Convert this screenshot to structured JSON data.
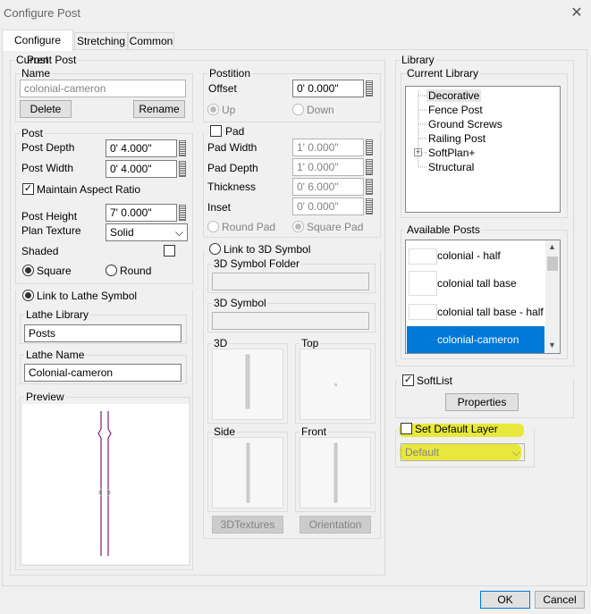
{
  "window": {
    "title": "Configure Post"
  },
  "tabs": [
    {
      "label": "Configure Post",
      "active": true
    },
    {
      "label": "Stretching",
      "active": false
    },
    {
      "label": "Common",
      "active": false
    }
  ],
  "current_post": {
    "group_label": "Current Post",
    "name_group": "Name",
    "name_value": "colonial-cameron",
    "delete_label": "Delete",
    "rename_label": "Rename"
  },
  "post": {
    "group_label": "Post",
    "depth_label": "Post Depth",
    "depth_value": "0' 4.000\"",
    "width_label": "Post Width",
    "width_value": "0' 4.000\"",
    "maintain_label": "Maintain Aspect Ratio",
    "maintain_checked": true,
    "height_label": "Post Height",
    "height_value": "7' 0.000\"",
    "texture_label": "Plan Texture",
    "texture_value": "Solid",
    "shaded_label": "Shaded",
    "square_label": "Square",
    "round_label": "Round"
  },
  "lathe": {
    "link_label": "Link to Lathe Symbol",
    "library_group": "Lathe Library",
    "library_value": "Posts",
    "name_group": "Lathe Name",
    "name_value": "Colonial-cameron",
    "preview_group": "Preview"
  },
  "position": {
    "group_label": "Postition",
    "offset_label": "Offset",
    "offset_value": "0' 0.000\"",
    "up_label": "Up",
    "down_label": "Down"
  },
  "pad": {
    "group_label": "Pad",
    "width_label": "Pad Width",
    "width_value": "1' 0.000\"",
    "depth_label": "Pad Depth",
    "depth_value": "1' 0.000\"",
    "thickness_label": "Thickness",
    "thickness_value": "0' 6.000\"",
    "inset_label": "Inset",
    "inset_value": "0' 0.000\"",
    "round_label": "Round Pad",
    "square_label": "Square Pad"
  },
  "symbol3d": {
    "link_label": "Link to 3D Symbol",
    "folder_group": "3D Symbol Folder",
    "symbol_group": "3D Symbol",
    "view_3d": "3D",
    "view_top": "Top",
    "view_side": "Side",
    "view_front": "Front",
    "textures_label": "3DTextures",
    "orientation_label": "Orientation"
  },
  "library": {
    "group_label": "Library",
    "current_group": "Current Library",
    "tree": [
      "Decorative",
      "Fence Post",
      "Ground Screws",
      "Railing Post",
      "SoftPlan+",
      "Structural"
    ],
    "available_group": "Available Posts",
    "posts": [
      "colonial  - half",
      "colonial tall base",
      "colonial tall base - half",
      "colonial-cameron"
    ]
  },
  "softlist": {
    "label": "SoftList",
    "checked": true,
    "properties_label": "Properties"
  },
  "layer": {
    "set_default_label": "Set Default Layer",
    "layer_value": "Default",
    "highlight_color": "#e6e600"
  },
  "footer": {
    "ok_label": "OK",
    "cancel_label": "Cancel"
  }
}
